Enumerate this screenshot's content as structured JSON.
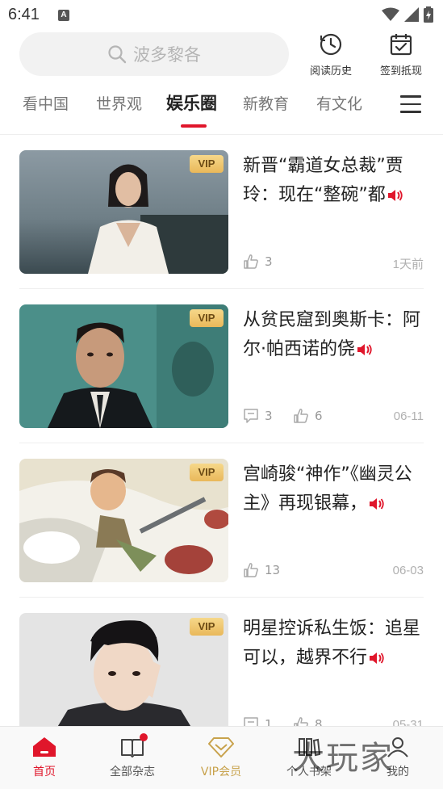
{
  "status": {
    "time": "6:41",
    "notif_letter": "A"
  },
  "search": {
    "placeholder": "波多黎各"
  },
  "top_actions": [
    {
      "label": "阅读历史",
      "icon": "history-icon"
    },
    {
      "label": "签到抵现",
      "icon": "calendar-check-icon"
    }
  ],
  "tabs": [
    {
      "label": "看中国",
      "active": false
    },
    {
      "label": "世界观",
      "active": false
    },
    {
      "label": "娱乐圈",
      "active": true
    },
    {
      "label": "新教育",
      "active": false
    },
    {
      "label": "有文化",
      "active": false
    }
  ],
  "articles": [
    {
      "badge": "VIP",
      "title": "新晋“霸道女总裁”贾玲：现在“整碗”都",
      "comments": "",
      "likes": "3",
      "date": "1天前"
    },
    {
      "badge": "VIP",
      "title": "从贫民窟到奥斯卡：阿尔·帕西诺的侥",
      "comments": "3",
      "likes": "6",
      "date": "06-11"
    },
    {
      "badge": "VIP",
      "title": "宫崎骏“神作”《幽灵公主》再现银幕，",
      "comments": "",
      "likes": "13",
      "date": "06-03"
    },
    {
      "badge": "VIP",
      "title": "明星控诉私生饭：追星可以，越界不行",
      "comments": "1",
      "likes": "8",
      "date": "05-31"
    }
  ],
  "bottom_nav": [
    {
      "label": "首页",
      "icon": "home-icon",
      "active": true
    },
    {
      "label": "全部杂志",
      "icon": "book-icon",
      "active": false
    },
    {
      "label": "VIP会员",
      "icon": "vip-diamond-icon",
      "active": false
    },
    {
      "label": "个人书架",
      "icon": "bookshelf-icon",
      "active": false
    },
    {
      "label": "我的",
      "icon": "profile-icon",
      "active": false
    }
  ],
  "watermark": "大玩家",
  "colors": {
    "accent": "#e0162b",
    "vip_gold": "#c8a24c",
    "text_main": "#222222",
    "text_muted": "#999999"
  }
}
